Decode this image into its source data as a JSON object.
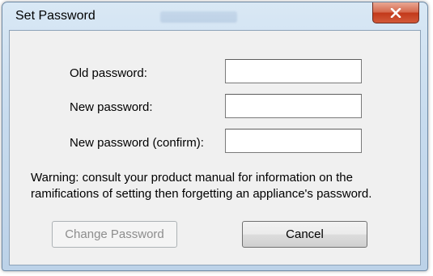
{
  "window": {
    "title": "Set Password",
    "close_icon": "close-icon"
  },
  "form": {
    "old_password_label": "Old password:",
    "old_password_value": "",
    "new_password_label": "New password:",
    "new_password_value": "",
    "confirm_password_label": "New password (confirm):",
    "confirm_password_value": ""
  },
  "warning_text": "Warning: consult your product manual for information on the ramifications of setting then forgetting an appliance's password.",
  "buttons": {
    "change_password_label": "Change Password",
    "change_password_enabled": false,
    "cancel_label": "Cancel"
  },
  "colors": {
    "close_button": "#c7442a",
    "dialog_background": "#f0f0f0",
    "frame": "#c7dbee",
    "disabled_text": "#8d8d8d"
  }
}
